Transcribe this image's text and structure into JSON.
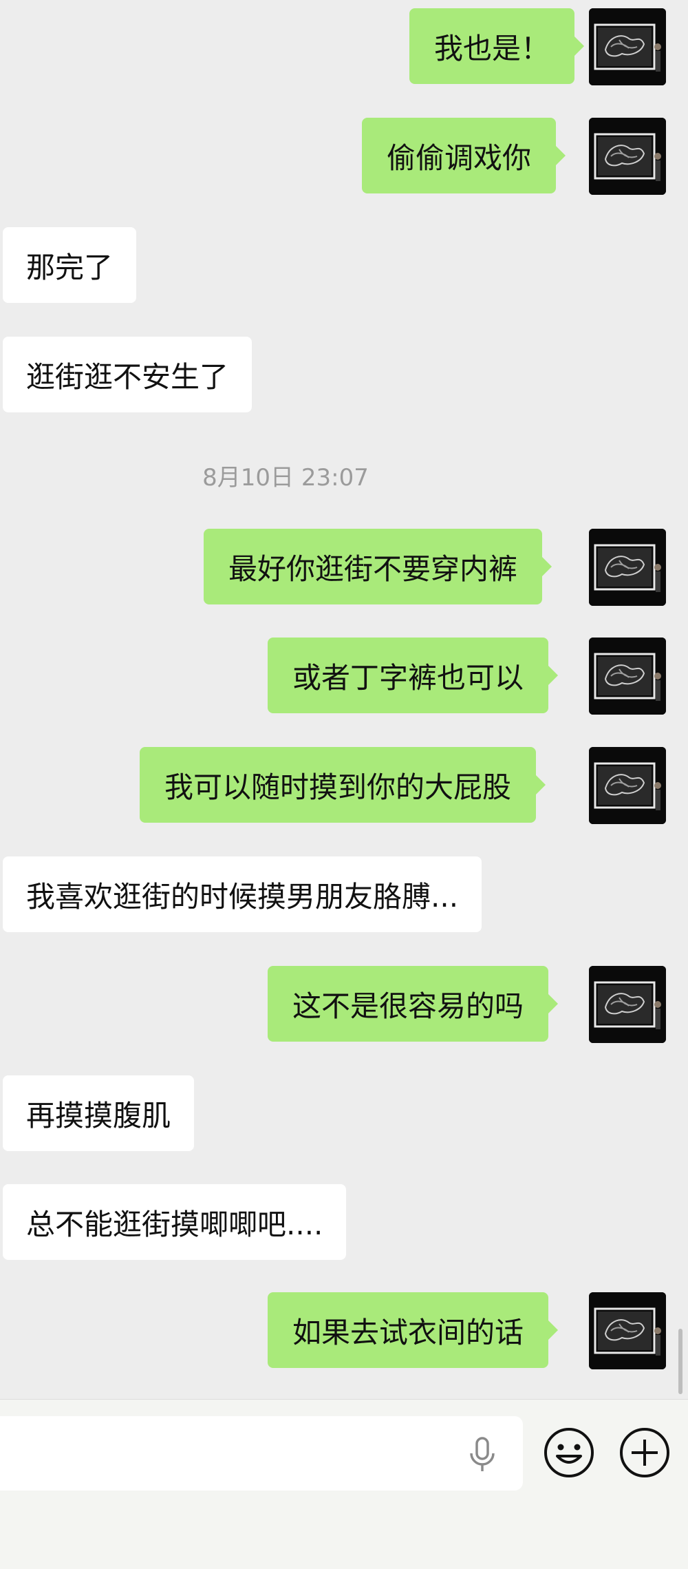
{
  "messages": [
    {
      "text": "我也是！"
    },
    {
      "text": "偷偷调戏你"
    },
    {
      "text": "那完了"
    },
    {
      "text": "逛街逛不安生了"
    },
    {
      "text": "最好你逛街不要穿内裤"
    },
    {
      "text": "或者丁字裤也可以"
    },
    {
      "text": "我可以随时摸到你的大屁股"
    },
    {
      "text": "我喜欢逛街的时候摸男朋友胳膊..."
    },
    {
      "text": "这不是很容易的吗"
    },
    {
      "text": "再摸摸腹肌"
    },
    {
      "text": "总不能逛街摸唧唧吧...."
    },
    {
      "text": "如果去试衣间的话"
    }
  ],
  "timestamp": "8月10日 23:07",
  "composer": {
    "input_value": "",
    "icons": [
      "microphone-icon",
      "emoji-icon",
      "plus-icon"
    ]
  },
  "colors": {
    "background": "#ededed",
    "outgoing_bubble": "#a9ea7a",
    "incoming_bubble": "#ffffff",
    "timestamp_text": "#9b9b9b"
  }
}
